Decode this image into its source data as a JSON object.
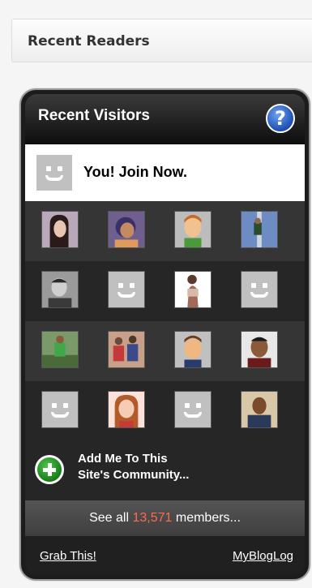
{
  "section": {
    "title": "Recent Readers"
  },
  "widget": {
    "title": "Recent Visitors",
    "help_label": "?",
    "join_text": "You! Join Now.",
    "visitors": [
      [
        "photo",
        "photo",
        "photo",
        "photo"
      ],
      [
        "photo",
        "default",
        "photo",
        "default"
      ],
      [
        "photo",
        "photo",
        "photo",
        "photo"
      ],
      [
        "default",
        "photo",
        "default",
        "photo"
      ]
    ],
    "add_me_line1": "Add Me To This",
    "add_me_line2": "Site's Community...",
    "see_all_prefix": "See all ",
    "member_count": "13,571",
    "see_all_suffix": " members...",
    "grab_link": "Grab This!",
    "mybloglog_link": "MyBlogLog"
  },
  "colors": {
    "member_count": "#ff6a4a",
    "help_blue": "#1c4fb3",
    "plus_green": "#137a13"
  }
}
